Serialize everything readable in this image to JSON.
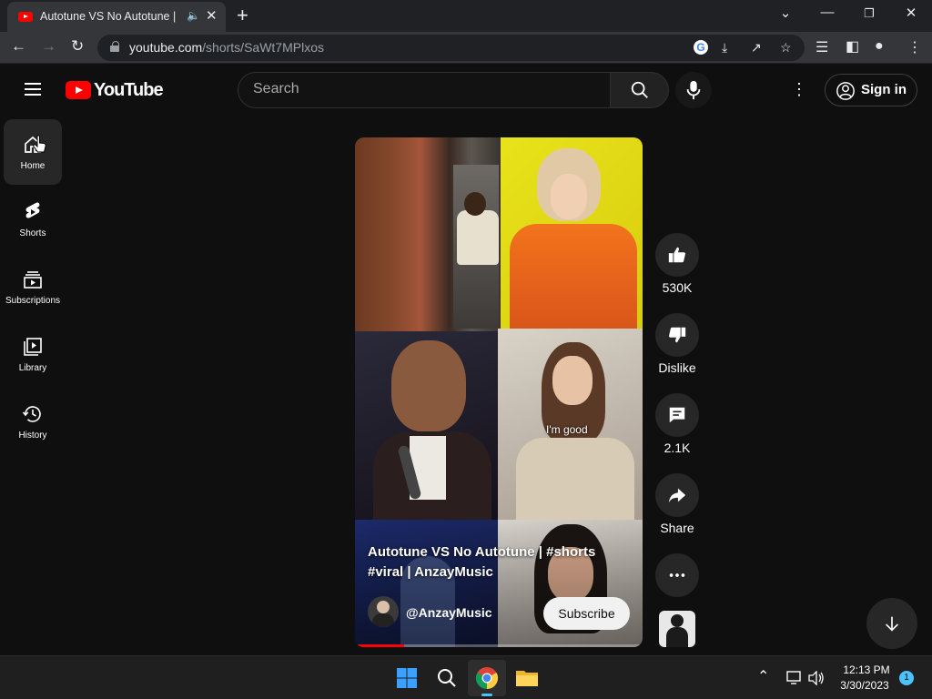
{
  "browser": {
    "tab_title": "Autotune VS No Autotune | #",
    "new_tab_glyph": "+",
    "url_host": "youtube.com",
    "url_path": "/shorts/SaWt7MPlxos"
  },
  "youtube": {
    "logo_text": "YouTube",
    "search_placeholder": "Search",
    "signin_label": "Sign in",
    "sidebar": [
      {
        "label": "Home",
        "icon": "home-icon"
      },
      {
        "label": "Shorts",
        "icon": "shorts-icon"
      },
      {
        "label": "Subscriptions",
        "icon": "subscriptions-icon"
      },
      {
        "label": "Library",
        "icon": "library-icon"
      },
      {
        "label": "History",
        "icon": "history-icon"
      }
    ]
  },
  "short": {
    "title": "Autotune VS No Autotune | #shorts #viral | AnzayMusic",
    "channel": "@AnzayMusic",
    "subscribe_label": "Subscribe",
    "overlay_caption": "I'm good",
    "likes": "530K",
    "dislike_label": "Dislike",
    "comments": "2.1K",
    "share_label": "Share",
    "progress": 0.17
  },
  "taskbar": {
    "time": "12:13 PM",
    "date": "3/30/2023",
    "notification_count": "1"
  },
  "colors": {
    "brand_red": "#ff0000",
    "background": "#0f0f0f",
    "chip": "#272727"
  }
}
